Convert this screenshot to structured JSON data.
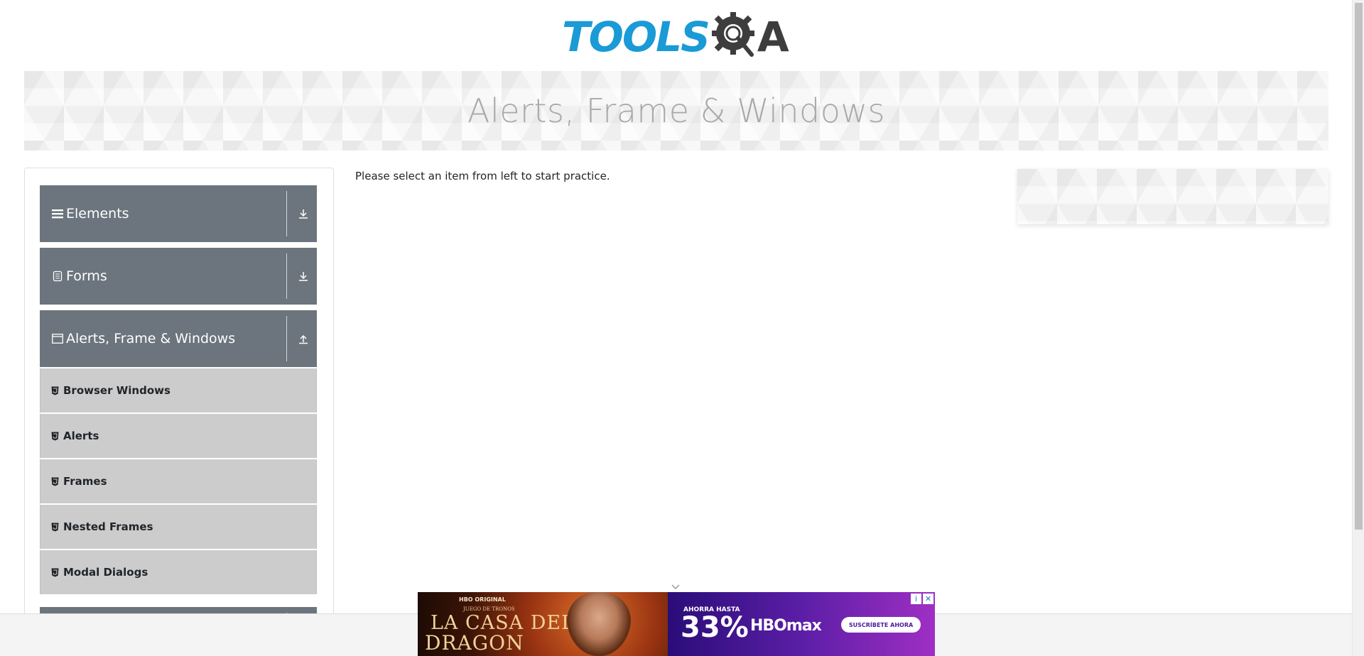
{
  "header": {
    "logo_text": "TOOLS",
    "logo_suffix": "A"
  },
  "banner": {
    "title": "Alerts, Frame & Windows"
  },
  "sidebar": {
    "groups": [
      {
        "label": "Elements",
        "icon": "hamburger-icon",
        "arrow": "download-arrow-icon"
      },
      {
        "label": "Forms",
        "icon": "form-icon",
        "arrow": "download-arrow-icon"
      },
      {
        "label": "Alerts, Frame & Windows",
        "icon": "window-icon",
        "arrow": "upload-arrow-icon",
        "expanded": true
      }
    ],
    "sub_items": [
      {
        "label": "Browser Windows",
        "icon": "html5-icon"
      },
      {
        "label": "Alerts",
        "icon": "html5-icon"
      },
      {
        "label": "Frames",
        "icon": "html5-icon"
      },
      {
        "label": "Nested Frames",
        "icon": "html5-icon"
      },
      {
        "label": "Modal Dialogs",
        "icon": "html5-icon"
      }
    ]
  },
  "main": {
    "message": "Please select an item from left to start practice."
  },
  "ad": {
    "hbo_original": "HBO ORIGINAL",
    "juego": "JUEGO DE TRONOS",
    "title_line1": "LA CASA DEL",
    "title_line2": "DRAGON",
    "ahorra": "AHORRA HASTA",
    "percent": "33%",
    "brand": "HBOmax",
    "cta": "SUSCRÍBETE AHORA",
    "info": "i",
    "close": "✕"
  },
  "colors": {
    "brand_blue": "#1a9ad6",
    "logo_dark": "#3d3d3d",
    "group_bg": "#6c757d",
    "sub_item_bg": "#cccccc",
    "banner_title": "#a9a9a9"
  }
}
